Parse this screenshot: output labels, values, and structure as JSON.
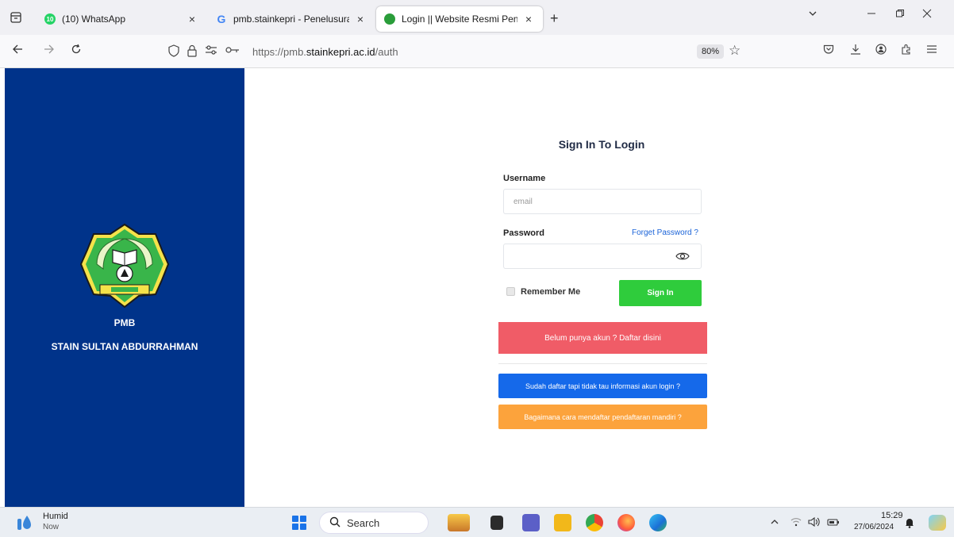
{
  "browser": {
    "tabs": [
      {
        "title": "(10) WhatsApp",
        "badge": "10",
        "close": "×"
      },
      {
        "title": "pmb.stainkepri - Penelusuran G",
        "close": "×"
      },
      {
        "title": "Login || Website Resmi Penerim",
        "close": "×"
      }
    ],
    "new_tab": "+",
    "url_prefix": "https://pmb.",
    "url_domain": "stainkepri.ac.id",
    "url_path": "/auth",
    "zoom": "80%"
  },
  "sidebar": {
    "title": "PMB",
    "institution": "STAIN SULTAN ABDURRAHMAN"
  },
  "login": {
    "heading": "Sign In To Login",
    "username_label": "Username",
    "username_placeholder": "email",
    "password_label": "Password",
    "forget_password": "Forget Password ?",
    "remember_me": "Remember Me",
    "sign_in": "Sign In",
    "register": "Belum punya akun ? Daftar disini",
    "login_info": "Sudah daftar tapi tidak tau informasi akun login ?",
    "how_to_register": "Bagaimana cara mendaftar pendaftaran mandiri ?"
  },
  "colors": {
    "sidebar_bg": "#00338a",
    "sign_in_btn": "#2fcc3c",
    "register_btn": "#f05c67",
    "info_btn": "#1569ea",
    "mandiri_btn": "#fca33c"
  },
  "taskbar": {
    "weather_title": "Humid",
    "weather_sub": "Now",
    "search": "Search",
    "time": "15:29",
    "date": "27/06/2024"
  }
}
